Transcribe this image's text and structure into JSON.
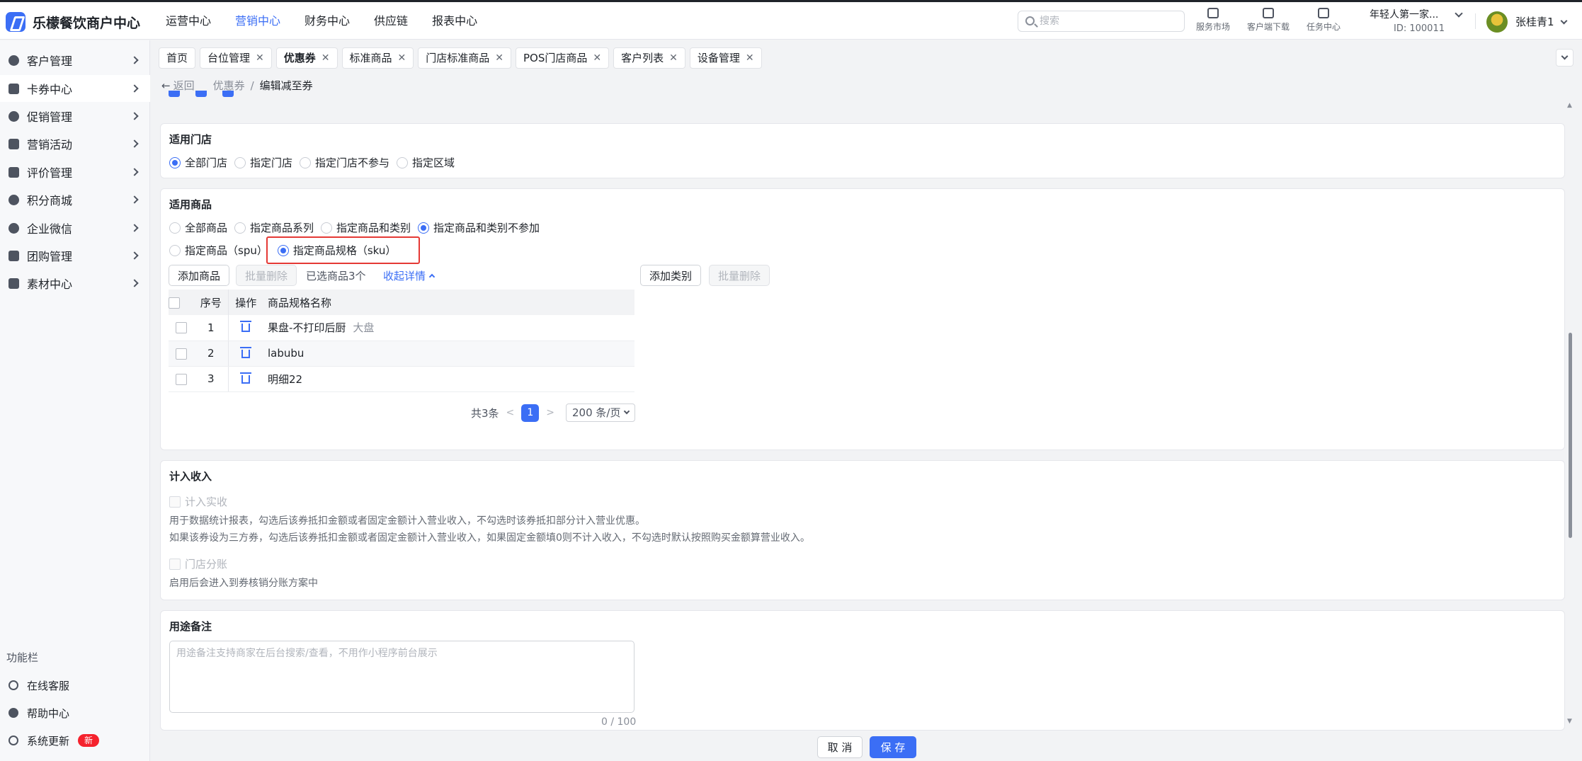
{
  "app": {
    "title": "乐檬餐饮商户中心"
  },
  "topnav": [
    "运营中心",
    "营销中心",
    "财务中心",
    "供应链",
    "报表中心"
  ],
  "search": {
    "placeholder": "搜索"
  },
  "tools": [
    "服务市场",
    "客户端下载",
    "任务中心"
  ],
  "merchant": {
    "name": "年轻人第一家...",
    "id": "ID: 100011"
  },
  "user": {
    "name": "张桂青1"
  },
  "sidebar": {
    "items": [
      "客户管理",
      "卡券中心",
      "促销管理",
      "营销活动",
      "评价管理",
      "积分商城",
      "企业微信",
      "团购管理",
      "素材中心"
    ],
    "func_title": "功能栏",
    "func_items": [
      "在线客服",
      "帮助中心",
      "系统更新"
    ],
    "badge_new": "新"
  },
  "tabs": [
    "首页",
    "台位管理",
    "优惠券",
    "标准商品",
    "门店标准商品",
    "POS门店商品",
    "客户列表",
    "设备管理"
  ],
  "breadcrumb": {
    "back": "返回",
    "parent": "优惠券",
    "sep": "/",
    "current": "编辑减至券"
  },
  "stores": {
    "title": "适用门店",
    "options": [
      "全部门店",
      "指定门店",
      "指定门店不参与",
      "指定区域"
    ]
  },
  "goods": {
    "title": "适用商品",
    "row1": [
      "全部商品",
      "指定商品系列",
      "指定商品和类别",
      "指定商品和类别不参加"
    ],
    "row2": [
      "指定商品（spu）",
      "指定商品规格（sku）"
    ],
    "add_goods": "添加商品",
    "batch_delete": "批量删除",
    "selected": "已选商品3个",
    "collapse": "收起详情",
    "add_category": "添加类别",
    "batch_delete_cat": "批量删除",
    "table": {
      "headers": [
        "序号",
        "操作",
        "商品规格名称"
      ],
      "rows": [
        {
          "no": "1",
          "name": "果盘-不打印后厨",
          "tag": "大盘"
        },
        {
          "no": "2",
          "name": "labubu",
          "tag": ""
        },
        {
          "no": "3",
          "name": "明细22",
          "tag": ""
        }
      ]
    },
    "pager": {
      "total": "共3条",
      "page": "1",
      "size": "200 条/页",
      "prev": "<",
      "next": ">"
    }
  },
  "income": {
    "title": "计入收入",
    "check1": "计入实收",
    "desc1": "用于数据统计报表，勾选后该券抵扣金额或者固定金额计入营业收入，不勾选时该券抵扣部分计入营业优惠。",
    "desc2": "如果该券设为三方券，勾选后该券抵扣金额或者固定金额计入营业收入，如果固定金额填0则不计入收入，不勾选时默认按照购买金额算营业收入。",
    "check2": "门店分账",
    "desc3": "启用后会进入到券核销分账方案中"
  },
  "remark": {
    "title": "用途备注",
    "placeholder": "用途备注支持商家在后台搜索/查看，不用作小程序前台展示",
    "count": "0 / 100"
  },
  "footer": {
    "cancel": "取 消",
    "save": "保 存"
  },
  "colors": {
    "accent": "#3b6ef5",
    "highlight": "#e53935"
  }
}
